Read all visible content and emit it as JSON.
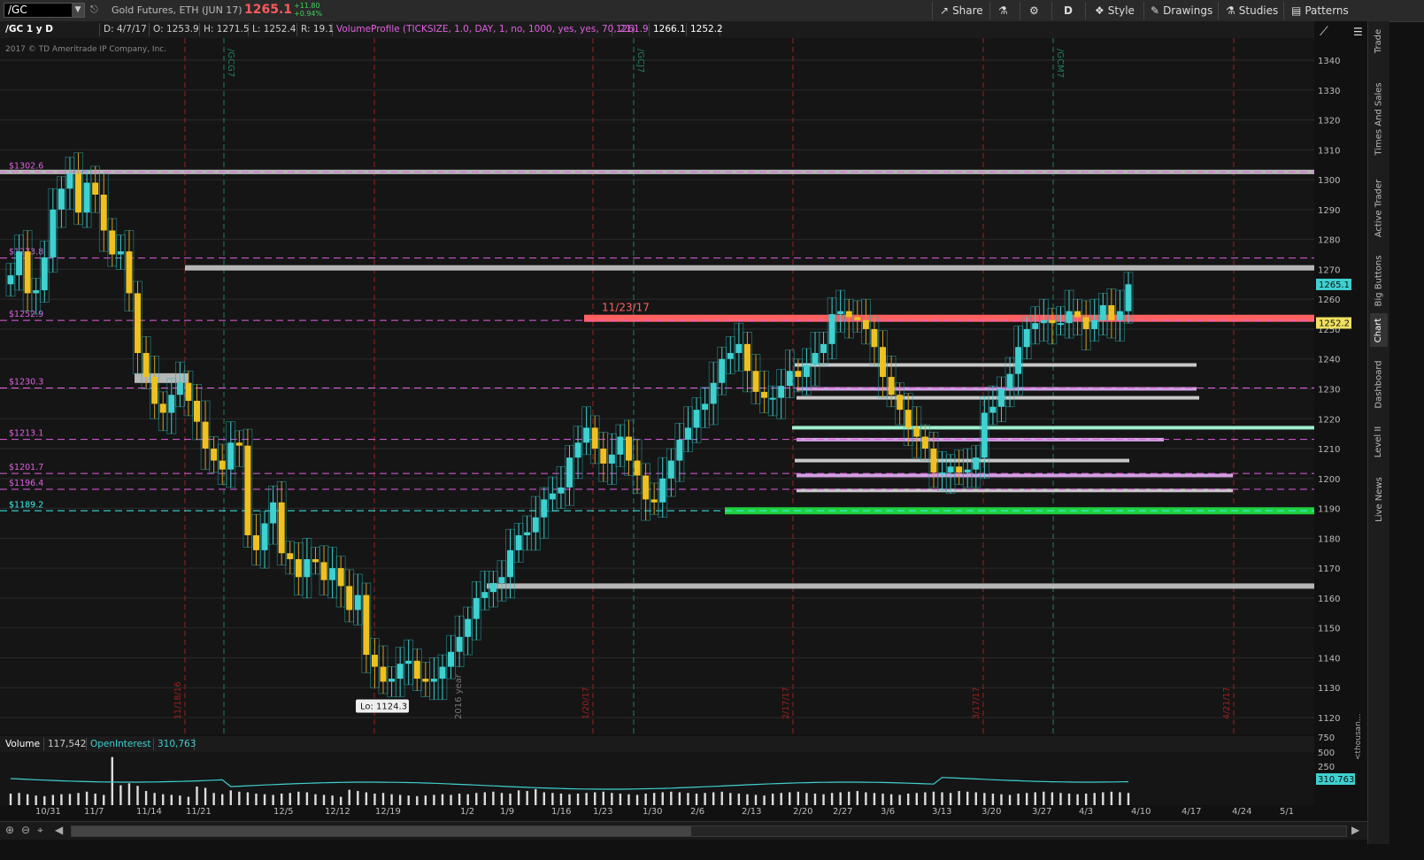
{
  "toolbar": {
    "symbol": "/GC",
    "description": "Gold Futures, ETH (JUN 17)",
    "last_price": "1265.1",
    "net_change": "+11.80",
    "pct_change": "+0.94%",
    "share_label": "Share",
    "period_label": "D",
    "style_label": "Style",
    "drawings_label": "Drawings",
    "studies_label": "Studies",
    "patterns_label": "Patterns"
  },
  "info_bar": {
    "title": "/GC 1 y D",
    "date": "D: 4/7/17",
    "open": "O: 1253.9",
    "high": "H: 1271.5",
    "low": "L: 1252.4",
    "close": "C: 1265.1",
    "range": "R: 19.1",
    "study": "VolumeProfile (TICKSIZE, 1.0, DAY, 1, no, 1000, yes, yes, 70, 21)",
    "vp1": "1261.9",
    "vp2": "1266.1",
    "vp3": "1252.2"
  },
  "copyright": "2017 © TD Ameritrade IP Company, Inc.",
  "price_axis": {
    "ticks": [
      "1340",
      "1330",
      "1320",
      "1310",
      "1300",
      "1290",
      "1280",
      "1270",
      "1260",
      "1250",
      "1240",
      "1230",
      "1220",
      "1210",
      "1200",
      "1190",
      "1180",
      "1170",
      "1160",
      "1150",
      "1140",
      "1130",
      "1120"
    ],
    "last_label": "1265.1",
    "vp_label": "1252.2"
  },
  "level_labels": [
    {
      "text": "$1302.6",
      "price": 1302.6,
      "color": "#e060e0"
    },
    {
      "text": "$1273.8",
      "price": 1273.8,
      "color": "#e060e0"
    },
    {
      "text": "$1252.9",
      "price": 1252.9,
      "color": "#e060e0"
    },
    {
      "text": "$1230.3",
      "price": 1230.3,
      "color": "#e060e0"
    },
    {
      "text": "$1213.1",
      "price": 1213.1,
      "color": "#e060e0"
    },
    {
      "text": "$1201.7",
      "price": 1201.7,
      "color": "#e060e0"
    },
    {
      "text": "$1196.4",
      "price": 1196.4,
      "color": "#e060e0"
    },
    {
      "text": "$1189.2",
      "price": 1189.2,
      "color": "#3ff0f0"
    }
  ],
  "annotations": {
    "zone_date": "11/23/17",
    "low_label": "Lo: 1124.3",
    "year_marker": "2016 year",
    "expiry_labels": [
      "/GCG7",
      "/GCJ7",
      "/GCM7"
    ],
    "date_markers": [
      "11/18/16",
      "1/20/17",
      "2/17/17",
      "3/17/17",
      "4/21/17"
    ]
  },
  "volume_header": {
    "volume_label": "Volume",
    "volume_value": "117,542",
    "oi_label": "OpenInterest",
    "oi_value": "310,763"
  },
  "volume_axis": {
    "ticks": [
      "750",
      "500",
      "250"
    ],
    "oi_label": "310.763",
    "unit": "<thousan..."
  },
  "x_axis": {
    "ticks": [
      "10/31",
      "11/7",
      "11/14",
      "11/21",
      "12/5",
      "12/12",
      "12/19",
      "1/2",
      "1/9",
      "1/16",
      "1/23",
      "1/30",
      "2/6",
      "2/13",
      "2/20",
      "2/27",
      "3/6",
      "3/13",
      "3/20",
      "3/27",
      "4/3",
      "4/10",
      "4/17",
      "4/24",
      "5/1"
    ]
  },
  "sidebar": {
    "tabs": [
      "Trade",
      "Times And Sales",
      "Active Trader",
      "Big Buttons",
      "Chart",
      "Dashboard",
      "Level II",
      "Live News"
    ]
  },
  "chart_data": {
    "type": "candlestick",
    "symbol": "/GC",
    "interval": "1 y D",
    "ylim": [
      1115,
      1348
    ],
    "closes": [
      1268,
      1276,
      1262,
      1263,
      1274,
      1290,
      1297,
      1302,
      1289,
      1299,
      1295,
      1283,
      1275,
      1276,
      1262,
      1242,
      1234,
      1225,
      1222,
      1228,
      1232,
      1226,
      1219,
      1210,
      1206,
      1203,
      1212,
      1211,
      1181,
      1176,
      1185,
      1192,
      1175,
      1173,
      1167,
      1173,
      1172,
      1166,
      1170,
      1164,
      1156,
      1161,
      1141,
      1137,
      1132,
      1133,
      1138,
      1139,
      1133,
      1132,
      1133,
      1137,
      1142,
      1147,
      1153,
      1160,
      1162,
      1165,
      1167,
      1176,
      1181,
      1182,
      1187,
      1193,
      1195,
      1197,
      1207,
      1212,
      1217,
      1210,
      1205,
      1208,
      1214,
      1206,
      1201,
      1193,
      1192,
      1200,
      1206,
      1213,
      1217,
      1223,
      1225,
      1232,
      1240,
      1242,
      1245,
      1236,
      1229,
      1227,
      1227,
      1231,
      1236,
      1234,
      1238,
      1242,
      1245,
      1255,
      1256,
      1254,
      1253,
      1250,
      1244,
      1234,
      1228,
      1223,
      1217,
      1214,
      1210,
      1202,
      1202,
      1204,
      1202,
      1203,
      1207,
      1222,
      1224,
      1230,
      1235,
      1244,
      1250,
      1252,
      1253,
      1252,
      1252,
      1256,
      1254,
      1250,
      1253,
      1258,
      1253,
      1256,
      1265
    ]
  },
  "volume_data": {
    "values": [
      180,
      190,
      170,
      150,
      140,
      160,
      170,
      175,
      190,
      210,
      180,
      160,
      750,
      310,
      340,
      300,
      220,
      190,
      170,
      160,
      150,
      130,
      290,
      270,
      190,
      170,
      230,
      210,
      200,
      180,
      170,
      160,
      180,
      190,
      210,
      200,
      170,
      160,
      150,
      130,
      240,
      220,
      200,
      180,
      190,
      170,
      160,
      150,
      140,
      150,
      160,
      170,
      160,
      180,
      170,
      190,
      200,
      210,
      190,
      180,
      230,
      220,
      250,
      200,
      190,
      180,
      170,
      180,
      190,
      200,
      210,
      190,
      180,
      170,
      160,
      180,
      190,
      200,
      210,
      200,
      190,
      180,
      190,
      200,
      210,
      190,
      180,
      170,
      160,
      150,
      180,
      190,
      200,
      210,
      190,
      180,
      170,
      190,
      200,
      210,
      220,
      200,
      190,
      180,
      170,
      160,
      180,
      190,
      200,
      210,
      200,
      190,
      220,
      210,
      200,
      190,
      180,
      170,
      160,
      180,
      190,
      200,
      210,
      200,
      190,
      180,
      170,
      180,
      190,
      200,
      210,
      200,
      190
    ]
  },
  "colors": {
    "up": "#3fd0d0",
    "down": "#f0c020",
    "background": "#151515",
    "accent_red": "#ff6060",
    "magenta": "#e060e0",
    "green": "#20d040"
  }
}
